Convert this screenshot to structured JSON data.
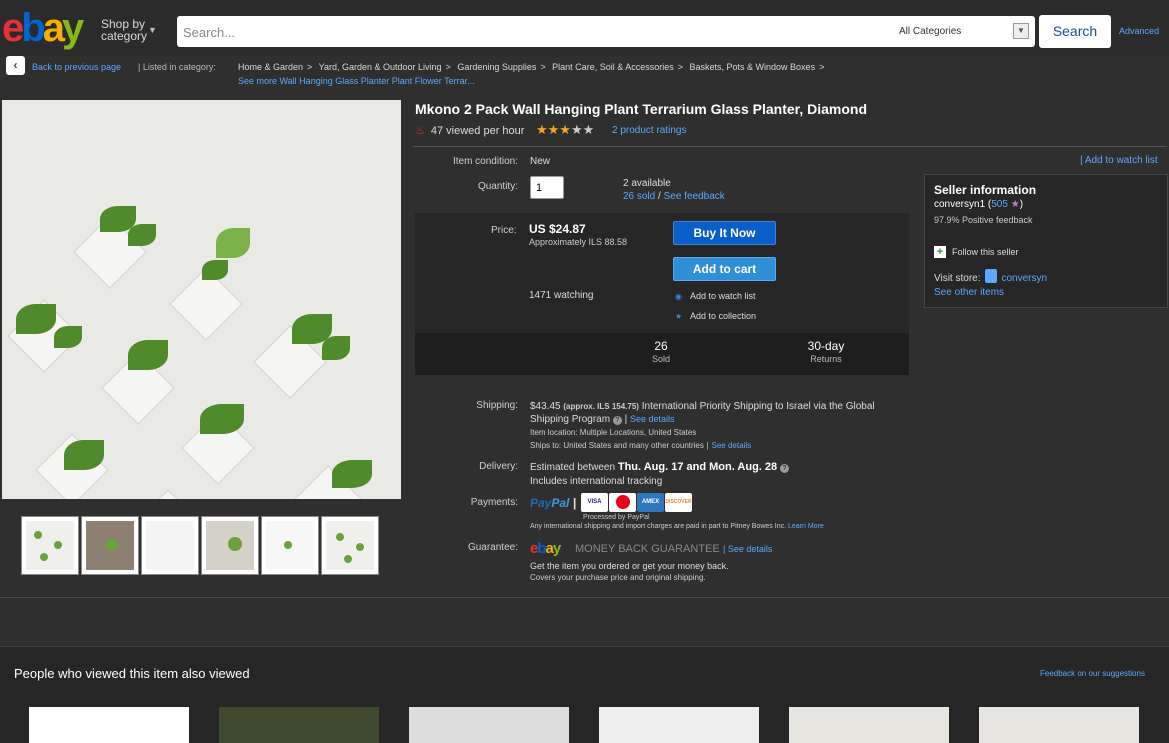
{
  "header": {
    "logo": [
      "e",
      "b",
      "a",
      "y"
    ],
    "shop_by": "Shop by",
    "category": "category",
    "search_placeholder": "Search...",
    "category_select": "All Categories",
    "search_button": "Search",
    "advanced": "Advanced"
  },
  "breadcrumb": {
    "back": "Back to previous page",
    "listed_in": "| Listed in category:",
    "items": [
      "Home & Garden",
      "Yard, Garden & Outdoor Living",
      "Gardening Supplies",
      "Plant Care, Soil & Accessories",
      "Baskets, Pots & Window Boxes"
    ],
    "see_more": "See more Wall Hanging Glass Planter Plant Flower Terrar..."
  },
  "product": {
    "title": "Mkono 2 Pack Wall Hanging Plant Terrarium Glass Planter, Diamond",
    "viewed_per_hour": "47 viewed per hour",
    "rating_stars": 3,
    "rating_max": 5,
    "ratings_link": "2 product ratings",
    "condition_label": "Item condition:",
    "condition": "New",
    "quantity_label": "Quantity:",
    "quantity_value": "1",
    "available": "2 available",
    "sold_link": "26 sold",
    "sold_sep": " / ",
    "feedback_link": "See feedback",
    "add_to_watch_top": "| Add to watch list"
  },
  "purchase": {
    "price_label": "Price:",
    "price": "US $24.87",
    "approx": "Approximately ILS 88.58",
    "buy_now": "Buy It Now",
    "add_to_cart": "Add to cart",
    "watching": "1471 watching",
    "add_watch": "Add to watch list",
    "add_collection": "Add to collection",
    "stats": [
      {
        "n": "26",
        "t": "Sold"
      },
      {
        "n": "30-day",
        "t": "Returns"
      }
    ]
  },
  "seller": {
    "title": "Seller information",
    "name": "conversyn1",
    "feedback_score": "505",
    "positive": "97.9% Positive feedback",
    "follow": "Follow this seller",
    "visit_store": "Visit store:",
    "store_name": "conversyn",
    "see_other": "See other items"
  },
  "shipping": {
    "shipping_label": "Shipping:",
    "cost": "$43.45",
    "cost_approx": "(approx. ILS 154.75)",
    "method": "International Priority Shipping to Israel via the Global Shipping Program",
    "see_details": "See details",
    "location": "Item location:  Multiple Locations, United States",
    "ships_to": "Ships to:  United States and many other countries",
    "delivery_label": "Delivery:",
    "delivery_prefix": "Estimated between",
    "delivery_dates": "Thu. Aug. 17 and Mon. Aug. 28",
    "tracking": "Includes international tracking",
    "payments_label": "Payments:",
    "paypal": [
      "Pay",
      "Pal"
    ],
    "cards": [
      "VISA",
      "MC",
      "AMEX",
      "DISCOVER"
    ],
    "processed": "Processed by PayPal",
    "intl_charges": "Any international shipping and import charges are paid in part to Pitney Bowes Inc.",
    "learn_more": "Learn More",
    "guarantee_label": "Guarantee:",
    "mbg": "MONEY BACK GUARANTEE",
    "guarantee_details": "| See details",
    "get_item": "Get the item you ordered or get your money back.",
    "covers": "Covers your purchase price and original shipping."
  },
  "also_viewed": {
    "title": "People who viewed this item also viewed",
    "feedback": "Feedback on our suggestions"
  },
  "colors": {
    "bg": "#2f2f2f",
    "link": "#5aa9ff",
    "buy_button": "#0a5ec8",
    "cart_button": "#2f8fd6",
    "star": "#f5a623"
  }
}
